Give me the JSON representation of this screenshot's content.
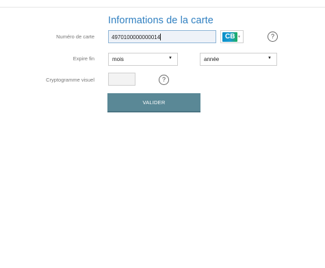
{
  "form": {
    "title": "Informations de la carte",
    "card_number": {
      "label": "Numéro de carte",
      "value": "4970100000000014",
      "card_type": "CB",
      "card_type_icon": "cb-card-logo-icon"
    },
    "expiry": {
      "label": "Expire fin",
      "month_value": "mois",
      "year_value": "année"
    },
    "cvv": {
      "label": "Cryptogramme visuel",
      "value": ""
    },
    "help_glyph": "?",
    "submit_label": "VALIDER",
    "colors": {
      "title": "#2f7fc0",
      "button": "#5a8896"
    }
  }
}
